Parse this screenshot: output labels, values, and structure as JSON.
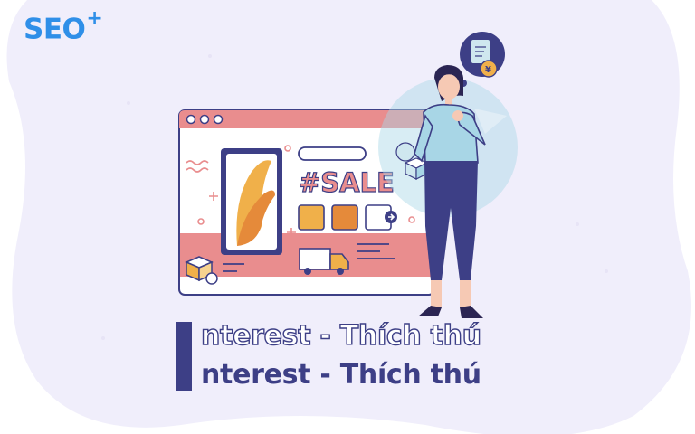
{
  "logo": {
    "text": "SEO",
    "sup": "+"
  },
  "screen": {
    "tag": "#SALE"
  },
  "headline": {
    "ghost": "nterest - Thích thú",
    "main": "nterest - Thích thú"
  },
  "bubble": {
    "coin_symbol": "¥"
  },
  "colors": {
    "background_blob": "#f0eefb",
    "browser_frame": "#e98d8e",
    "accent_yellow": "#f0b04a",
    "navy": "#3d3f86",
    "logo_blue": "#2f8fe8",
    "shirt": "#a8d6e6"
  }
}
